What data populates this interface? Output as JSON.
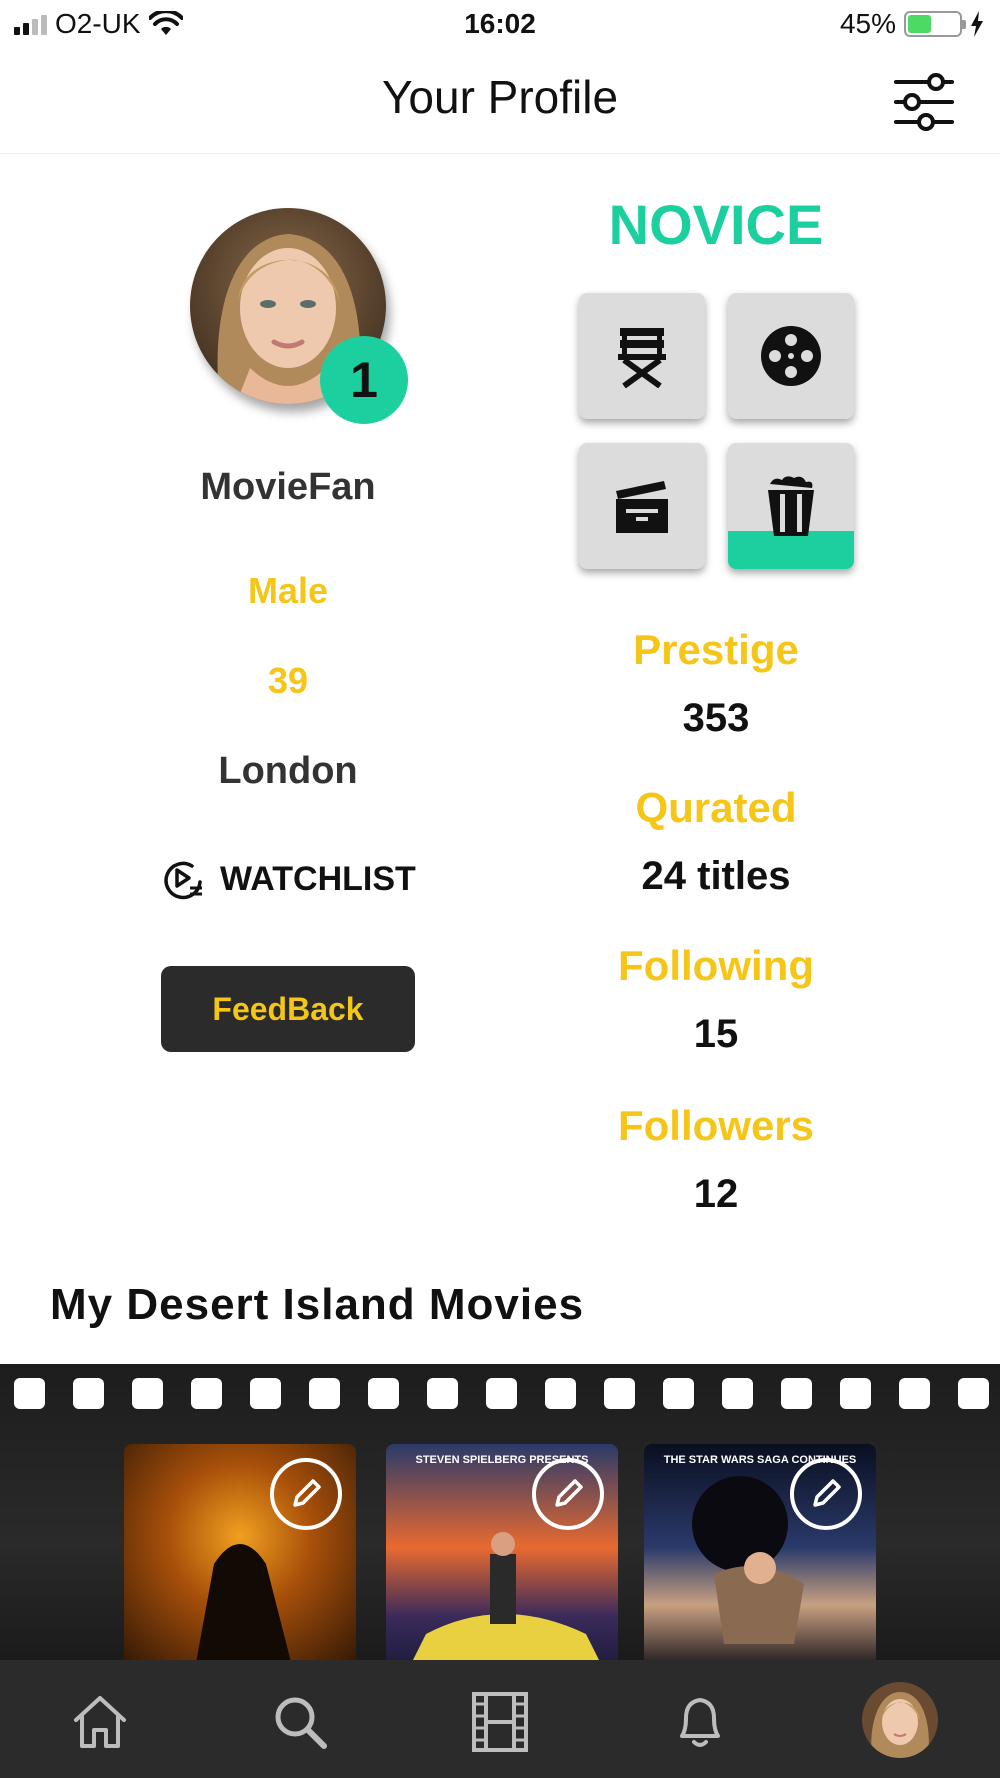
{
  "status_bar": {
    "carrier": "O2-UK",
    "time": "16:02",
    "battery_percent": "45%",
    "battery_level": 0.45
  },
  "header": {
    "title": "Your Profile"
  },
  "profile": {
    "level": "1",
    "username": "MovieFan",
    "gender": "Male",
    "age": "39",
    "city": "London",
    "watchlist_label": "WATCHLIST",
    "feedback_label": "FeedBack"
  },
  "rank": {
    "title": "NOVICE",
    "badges": [
      {
        "icon": "directors-chair-icon",
        "progress": 0
      },
      {
        "icon": "film-reel-icon",
        "progress": 0
      },
      {
        "icon": "clapperboard-icon",
        "progress": 0
      },
      {
        "icon": "popcorn-icon",
        "progress": 0.3
      }
    ]
  },
  "stats": [
    {
      "label": "Prestige",
      "value": "353"
    },
    {
      "label": "Qurated",
      "value": "24 titles"
    },
    {
      "label": "Following",
      "value": "15"
    },
    {
      "label": "Followers",
      "value": "12"
    }
  ],
  "desert_island": {
    "title": "My Desert Island Movies",
    "posters": [
      {
        "tag": ""
      },
      {
        "tag": "STEVEN SPIELBERG PRESENTS"
      },
      {
        "tag": "THE STAR WARS SAGA CONTINUES"
      }
    ]
  },
  "tabbar": {
    "items": [
      "home-icon",
      "search-icon",
      "film-icon",
      "bell-icon",
      "profile-avatar"
    ]
  },
  "colors": {
    "accent_teal": "#1ccf9e",
    "accent_yellow": "#f5c518",
    "dark": "#2b2b2b"
  }
}
